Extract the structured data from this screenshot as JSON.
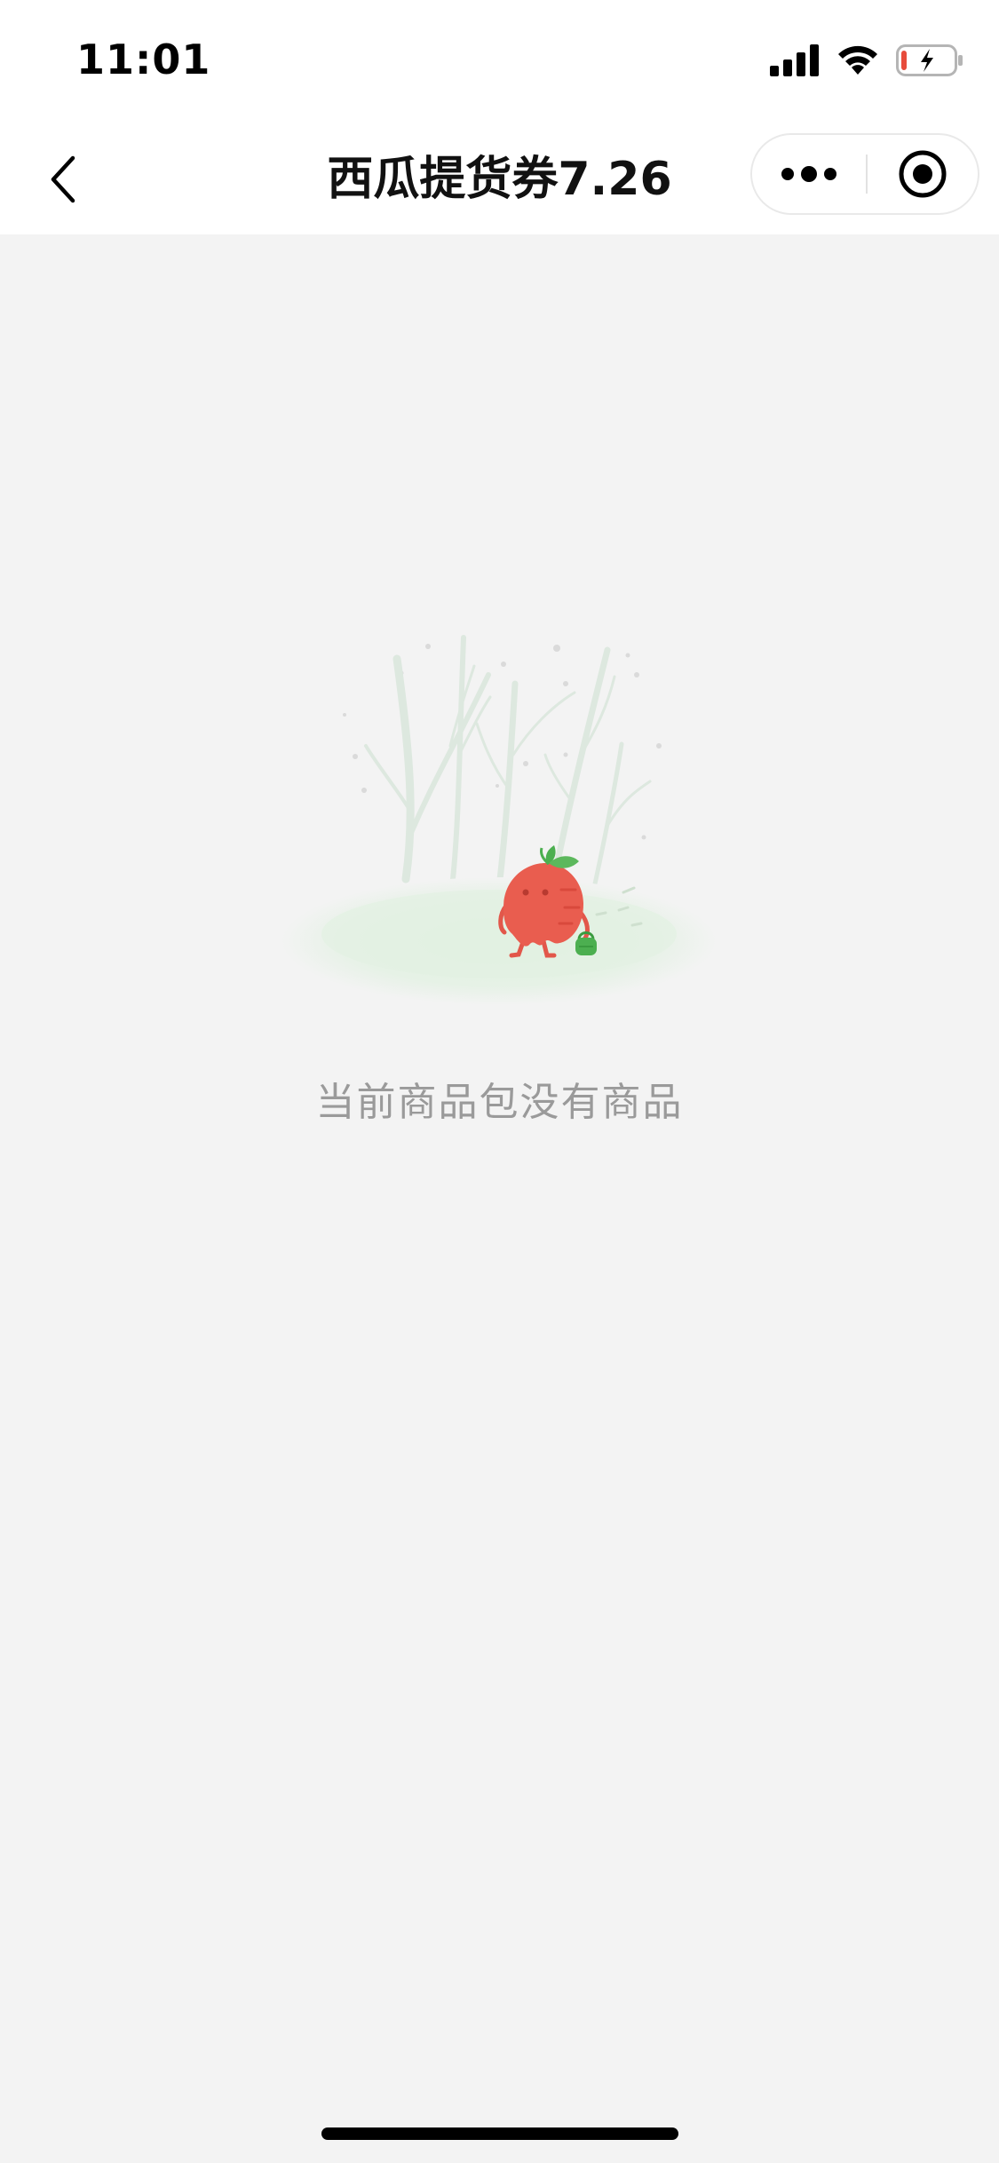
{
  "status_bar": {
    "time": "11:01",
    "icons": [
      "cellular-signal-icon",
      "wifi-icon",
      "battery-charging-icon"
    ],
    "battery_color": "#e74c3c"
  },
  "nav_bar": {
    "back_icon": "chevron-left-icon",
    "title": "西瓜提货券7.26",
    "more_icon": "more-dots-icon",
    "close_icon": "target-close-icon"
  },
  "empty_state": {
    "illustration": "carrot-under-trees-illustration",
    "message": "当前商品包没有商品"
  },
  "colors": {
    "background": "#f3f3f3",
    "carrot": "#e95d4f",
    "leaf": "#4caf50",
    "text_muted": "#9a9a9a"
  }
}
